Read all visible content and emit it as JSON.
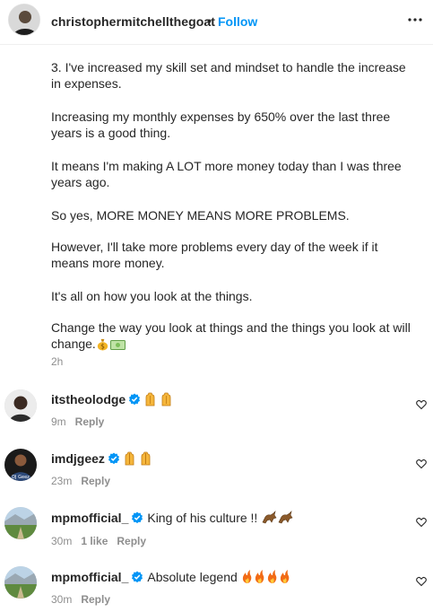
{
  "post": {
    "username": "christophermitchellthegoat",
    "separator": "•",
    "follow_label": "Follow",
    "more_icon": "more-options-icon",
    "caption": [
      "3. I've increased my skill set and mindset to handle the increase in expenses.",
      "Increasing my monthly expenses by 650% over the last three years is a good thing.",
      "It means I'm making A LOT more money today than I was three years ago.",
      "So yes, MORE MONEY MEANS MORE PROBLEMS.",
      "However, I'll take more problems every day of the week if it means more money.",
      "It's all on how you look at the things.",
      "Change the way you look at things and the things you look at will change."
    ],
    "caption_emojis": [
      "money-bag-emoji",
      "dollar-bill-emoji"
    ],
    "time": "2h"
  },
  "comments": [
    {
      "username": "itstheolodge",
      "text": "",
      "emoji": "raising-hands-emoji",
      "emoji_count": 2,
      "time": "9m",
      "likes": "",
      "reply_label": "Reply"
    },
    {
      "username": "imdjgeez",
      "text": "",
      "emoji": "folded-hands-emoji",
      "emoji_count": 2,
      "time": "23m",
      "likes": "",
      "reply_label": "Reply"
    },
    {
      "username": "mpmofficial_",
      "text": "King of his culture !!",
      "emoji": "goat-emoji",
      "emoji_count": 2,
      "time": "30m",
      "likes": "1 like",
      "reply_label": "Reply"
    },
    {
      "username": "mpmofficial_",
      "text": "Absolute legend",
      "emoji": "fire-emoji",
      "emoji_count": 4,
      "time": "30m",
      "likes": "",
      "reply_label": "Reply"
    }
  ],
  "colors": {
    "accent": "#0095f6",
    "verified": "#0095f6",
    "muted": "#8e8e8e",
    "text": "#262626"
  },
  "icons": {
    "verified": "verified-badge-icon",
    "heart": "heart-outline-icon"
  }
}
